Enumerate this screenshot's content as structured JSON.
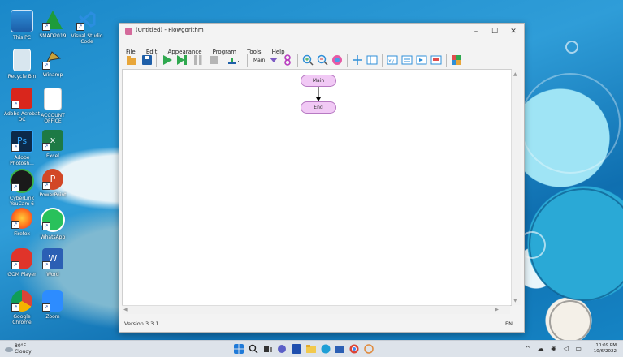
{
  "window": {
    "title": "(Untitled) - Flowgorithm",
    "controls": {
      "minimize": "–",
      "maximize": "☐",
      "close": "✕"
    }
  },
  "menu": [
    "File",
    "Edit",
    "Appearance",
    "Program",
    "Tools",
    "Help"
  ],
  "toolbar": {
    "function_select": "Main"
  },
  "flowchart": {
    "start": "Main",
    "end": "End"
  },
  "status": {
    "version": "Version 3.3.1",
    "language": "EN"
  },
  "desktop_icons": [
    {
      "label": "This PC"
    },
    {
      "label": "SMAD2019"
    },
    {
      "label": "Visual Studio Code"
    },
    {
      "label": "Recycle Bin"
    },
    {
      "label": "Winamp"
    },
    {
      "label": "Adobe Acrobat DC"
    },
    {
      "label": "ACCOUNT OFFICE"
    },
    {
      "label": "Adobe Photosh..."
    },
    {
      "label": "Excel"
    },
    {
      "label": "CyberLink YouCam 6"
    },
    {
      "label": "PowerPoint"
    },
    {
      "label": "Firefox"
    },
    {
      "label": "WhatsApp"
    },
    {
      "label": "GOM Player"
    },
    {
      "label": "Word"
    },
    {
      "label": "Google Chrome"
    },
    {
      "label": "Zoom"
    }
  ],
  "taskbar": {
    "weather_temp": "80°F",
    "weather_desc": "Cloudy",
    "time": "10:09 PM",
    "date": "10/6/2022",
    "tray_icons": "^ ☁ ◉ ◁ ▭"
  },
  "colors": {
    "node_fill": "#f1c9f5",
    "node_border": "#b77ac3",
    "desktop_blue": "#1a88c9"
  }
}
